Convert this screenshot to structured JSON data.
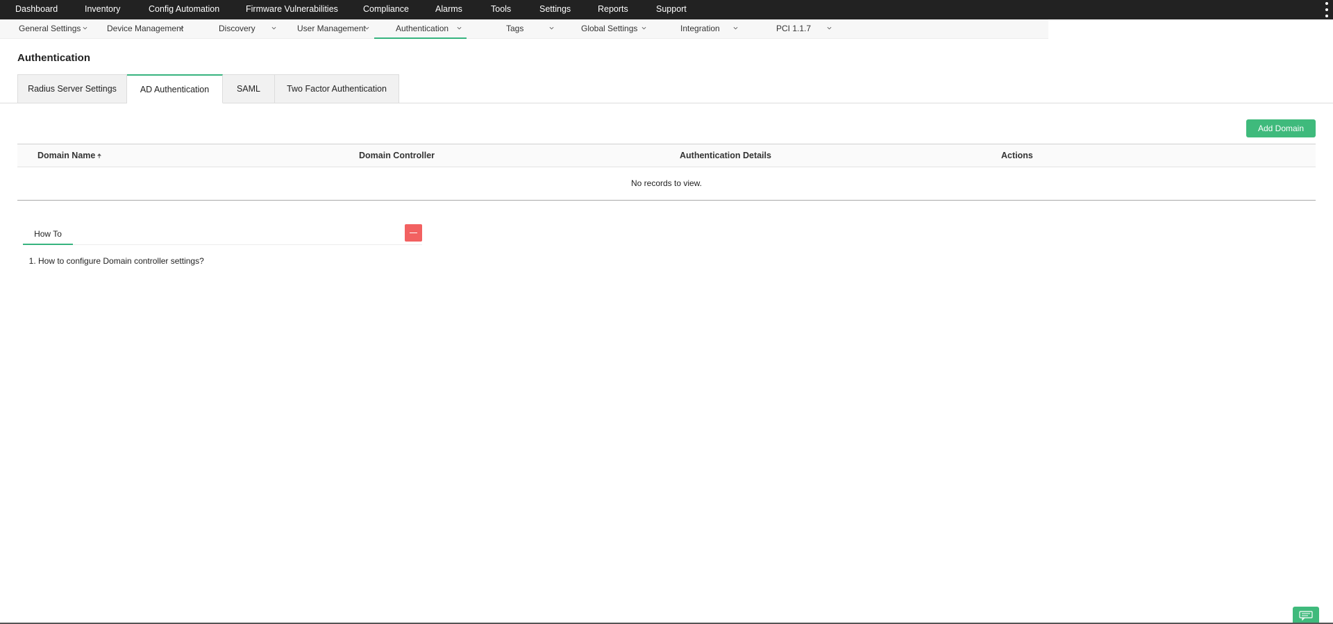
{
  "topnav": {
    "items": [
      {
        "label": "Dashboard"
      },
      {
        "label": "Inventory"
      },
      {
        "label": "Config Automation"
      },
      {
        "label": "Firmware Vulnerabilities"
      },
      {
        "label": "Compliance"
      },
      {
        "label": "Alarms"
      },
      {
        "label": "Tools"
      },
      {
        "label": "Settings"
      },
      {
        "label": "Reports"
      },
      {
        "label": "Support"
      }
    ]
  },
  "subnav": {
    "items": [
      {
        "label": "General Settings"
      },
      {
        "label": "Device Management"
      },
      {
        "label": "Discovery"
      },
      {
        "label": "User Management"
      },
      {
        "label": "Authentication",
        "active": true
      },
      {
        "label": "Tags"
      },
      {
        "label": "Global Settings"
      },
      {
        "label": "Integration"
      },
      {
        "label": "PCI 1.1.7"
      }
    ]
  },
  "page": {
    "title": "Authentication"
  },
  "tabs": [
    {
      "label": "Radius Server Settings"
    },
    {
      "label": "AD Authentication",
      "active": true
    },
    {
      "label": "SAML"
    },
    {
      "label": "Two Factor Authentication"
    }
  ],
  "actions": {
    "add_domain": "Add Domain"
  },
  "table": {
    "columns": [
      "Domain Name",
      "Domain Controller",
      "Authentication Details",
      "Actions"
    ],
    "empty_message": "No records to view."
  },
  "howto": {
    "tab_label": "How To",
    "items": [
      "How to configure Domain controller settings?"
    ]
  },
  "colors": {
    "accent": "#36b37e",
    "button": "#3fba7c",
    "collapse": "#f26161",
    "topnav": "#222222"
  }
}
